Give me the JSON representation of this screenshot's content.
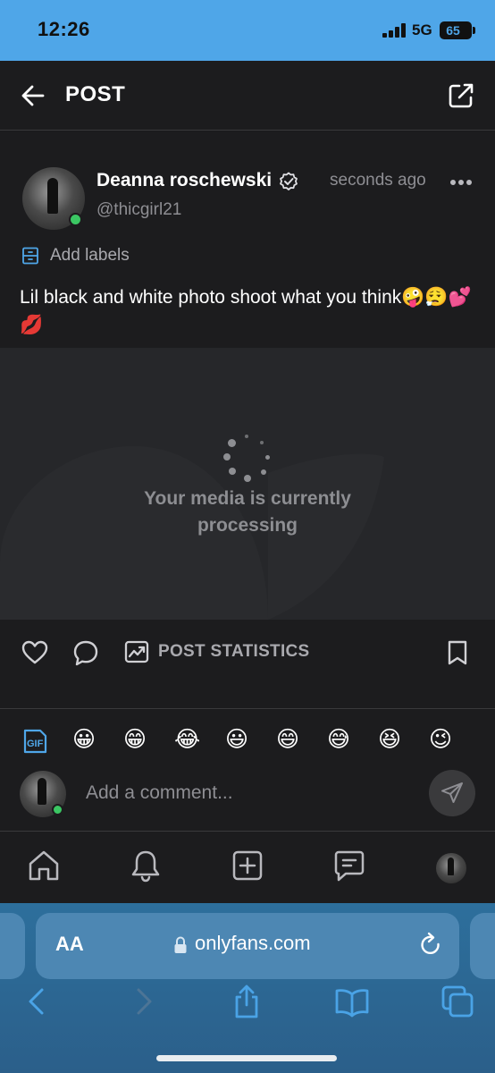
{
  "status_bar": {
    "time": "12:26",
    "network": "5G",
    "battery": "65"
  },
  "header": {
    "title": "POST",
    "icons": {
      "back": "arrow-left-icon",
      "share": "share-icon"
    }
  },
  "post": {
    "author_name": "Deanna roschewski",
    "author_handle": "@thicgirl21",
    "timestamp": "seconds ago",
    "add_labels": "Add labels",
    "caption": "Lil black and white photo shoot what you think🤪😮‍💨💕💋",
    "media_status": "Your media is currently processing"
  },
  "actions": {
    "post_statistics": "POST STATISTICS",
    "icons": [
      "heart-icon",
      "comment-icon",
      "chart-icon",
      "bookmark-icon"
    ]
  },
  "composer": {
    "gif_icon": "gif-icon",
    "quick_emojis": [
      "😀",
      "😁",
      "😂",
      "😃",
      "😄",
      "😅",
      "😆",
      "😉"
    ],
    "placeholder": "Add a comment..."
  },
  "bottom_nav": {
    "items": [
      "home-icon",
      "bell-icon",
      "plus-square-icon",
      "messages-icon",
      "profile-avatar"
    ]
  },
  "browser": {
    "aa_label": "AA",
    "url": "onlyfans.com"
  },
  "colors": {
    "status_bar": "#4fa6e8",
    "background": "#1c1c1e",
    "media_bg": "#26272a",
    "online": "#3bc763",
    "safari_bar": "#2d6f9c"
  }
}
